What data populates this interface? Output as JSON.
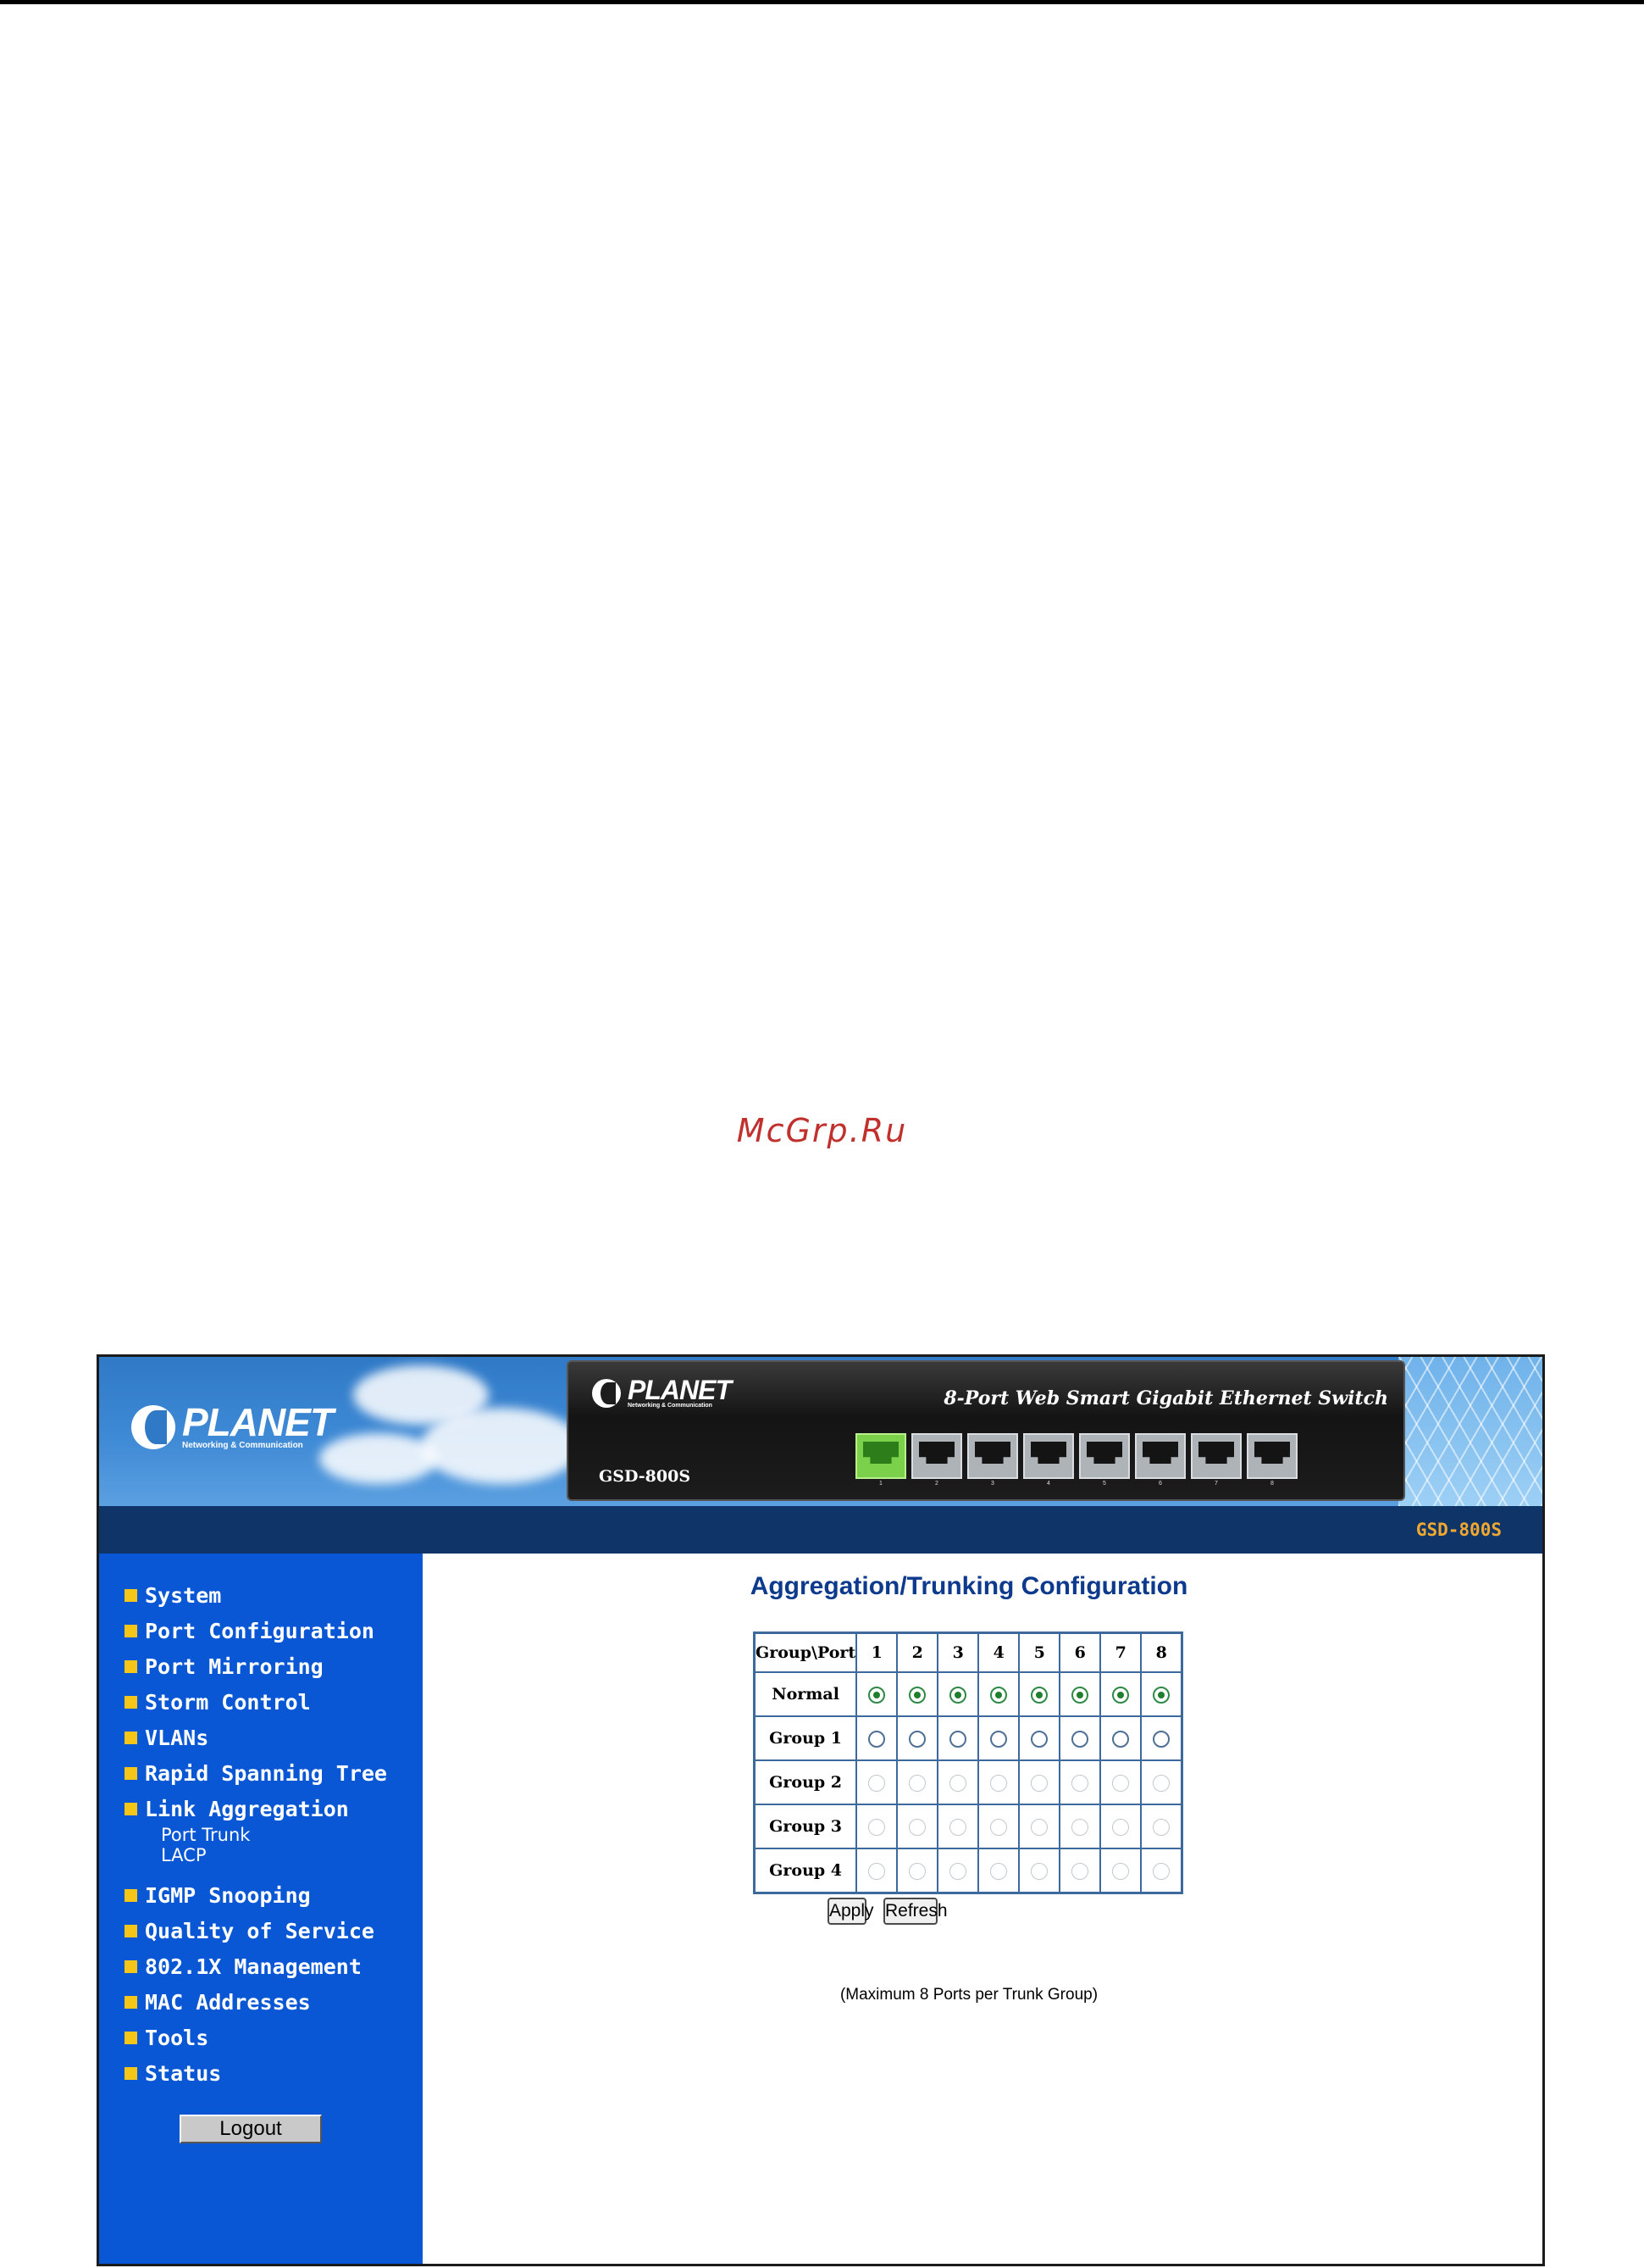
{
  "watermark": "McGrp.Ru",
  "banner": {
    "brand_word": "PLANET",
    "brand_tagline": "Networking & Communication",
    "device_title": "8-Port Web Smart Gigabit Ethernet Switch",
    "device_model": "GSD-800S",
    "port_labels": [
      "1",
      "2",
      "3",
      "4",
      "5",
      "6",
      "7",
      "8"
    ],
    "active_port": "1"
  },
  "nav_bar": {
    "model": "GSD-800S"
  },
  "sidebar": {
    "items_top": [
      "System",
      "Port Configuration",
      "Port Mirroring",
      "Storm Control",
      "VLANs",
      "Rapid Spanning Tree",
      "Link Aggregation"
    ],
    "sub_items": [
      "Port Trunk",
      "LACP"
    ],
    "items_bottom": [
      "IGMP Snooping",
      "Quality of Service",
      "802.1X Management",
      "MAC Addresses",
      "Tools",
      "Status"
    ],
    "logout_label": "Logout"
  },
  "main": {
    "title": "Aggregation/Trunking Configuration",
    "table": {
      "corner_header": "Group\\Port",
      "ports": [
        "1",
        "2",
        "3",
        "4",
        "5",
        "6",
        "7",
        "8"
      ],
      "rows": [
        {
          "label": "Normal",
          "state": "checked"
        },
        {
          "label": "Group 1",
          "state": "unchecked"
        },
        {
          "label": "Group 2",
          "state": "disabled"
        },
        {
          "label": "Group 3",
          "state": "disabled"
        },
        {
          "label": "Group 4",
          "state": "disabled"
        }
      ]
    },
    "apply_label": "Apply",
    "refresh_label": "Refresh",
    "note": "(Maximum 8 Ports per Trunk Group)"
  }
}
